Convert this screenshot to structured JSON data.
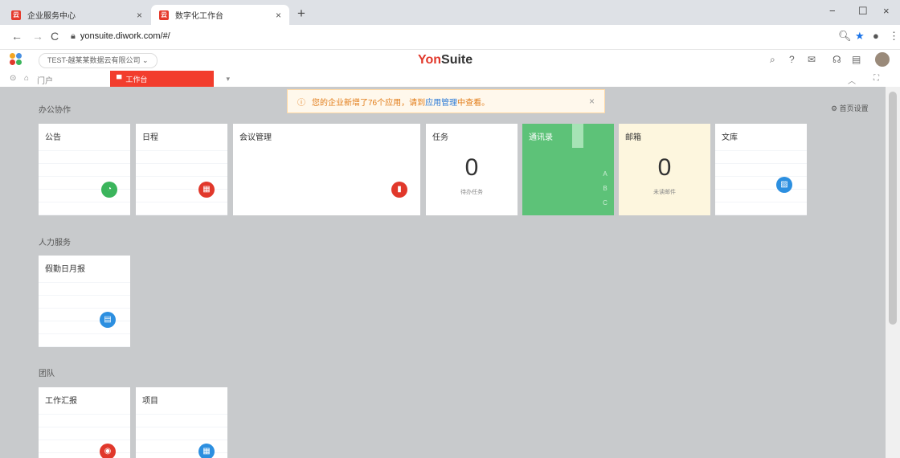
{
  "browser": {
    "tabs": [
      {
        "title": "企业服务中心",
        "close": "×"
      },
      {
        "title": "数字化工作台",
        "close": "×"
      }
    ],
    "new_tab": "+",
    "window_controls": [
      "−",
      "☐",
      "×"
    ],
    "nav": {
      "back": "←",
      "forward": "→",
      "reload": "C"
    },
    "url": "yonsuite.diwork.com/#/"
  },
  "app": {
    "tenant": "TEST-越某某数据云有限公司",
    "brand_prefix": "Yon",
    "brand_suffix": "Suite",
    "subnav": {
      "portal": "门户",
      "worktable": "工作台"
    }
  },
  "notice": {
    "prefix": "您的企业新增了76个应用，请到",
    "link": "应用管理",
    "suffix": "中查看。",
    "close": "×"
  },
  "page_settings": "首页设置",
  "sections": [
    {
      "title": "办公协作",
      "cards": [
        {
          "title": "公告"
        },
        {
          "title": "日程"
        },
        {
          "title": "会议管理"
        },
        {
          "title": "任务",
          "number": "0",
          "sub": "待办任务"
        },
        {
          "title": "通讯录",
          "letters": [
            "A",
            "B",
            "C"
          ]
        },
        {
          "title": "邮箱",
          "number": "0",
          "sub": "未读邮件"
        },
        {
          "title": "文库"
        }
      ]
    },
    {
      "title": "人力服务",
      "cards": [
        {
          "title": "假勤日月报"
        }
      ]
    },
    {
      "title": "团队",
      "cards": [
        {
          "title": "工作汇报"
        },
        {
          "title": "项目"
        }
      ]
    }
  ],
  "colors": {
    "brand_red": "#e1382b",
    "green": "#3bb55c",
    "blue": "#2c8fe0",
    "orange": "#e27c18"
  }
}
